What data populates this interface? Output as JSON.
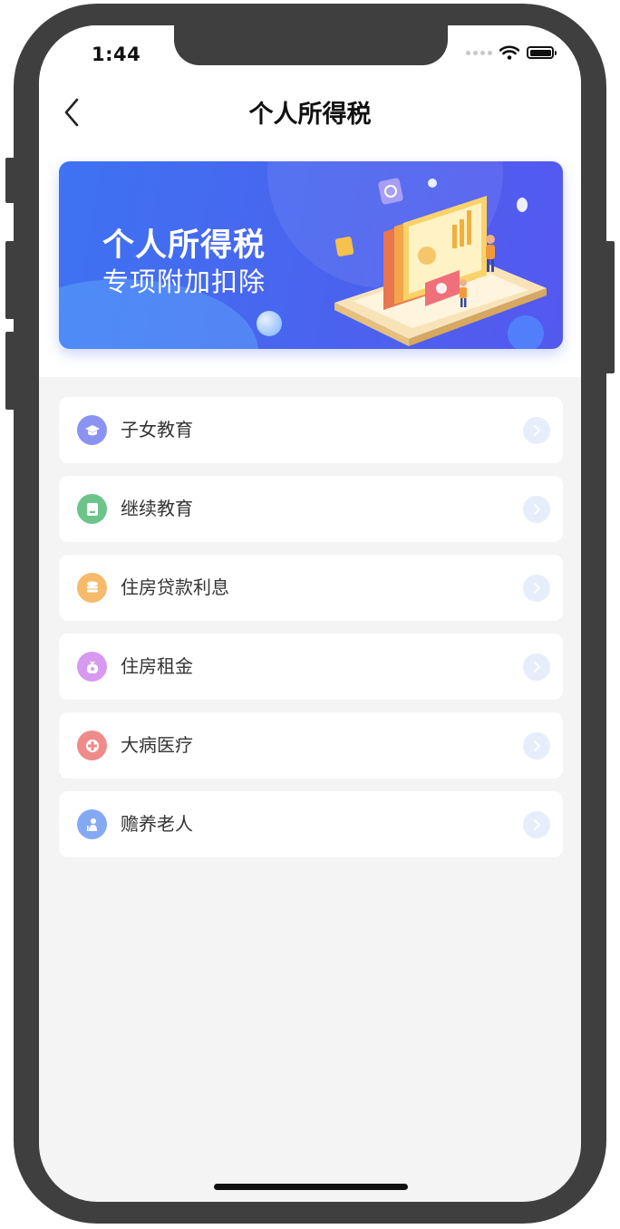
{
  "status_bar": {
    "time": "1:44"
  },
  "nav": {
    "title": "个人所得税"
  },
  "banner": {
    "title": "个人所得税",
    "subtitle": "专项附加扣除"
  },
  "items": [
    {
      "label": "子女教育",
      "icon": "graduation-cap-icon",
      "color": "#8b93f2"
    },
    {
      "label": "继续教育",
      "icon": "book-icon",
      "color": "#6cc48a"
    },
    {
      "label": "住房贷款利息",
      "icon": "coins-icon",
      "color": "#f5bb6b"
    },
    {
      "label": "住房租金",
      "icon": "money-bag-icon",
      "color": "#d79af0"
    },
    {
      "label": "大病医疗",
      "icon": "medical-cross-icon",
      "color": "#ef8b8b"
    },
    {
      "label": "赡养老人",
      "icon": "elderly-person-icon",
      "color": "#85a8f4"
    }
  ],
  "colors": {
    "accent": "#4a63ee",
    "background": "#f4f4f4",
    "arrow_bg": "#e6eefb"
  }
}
